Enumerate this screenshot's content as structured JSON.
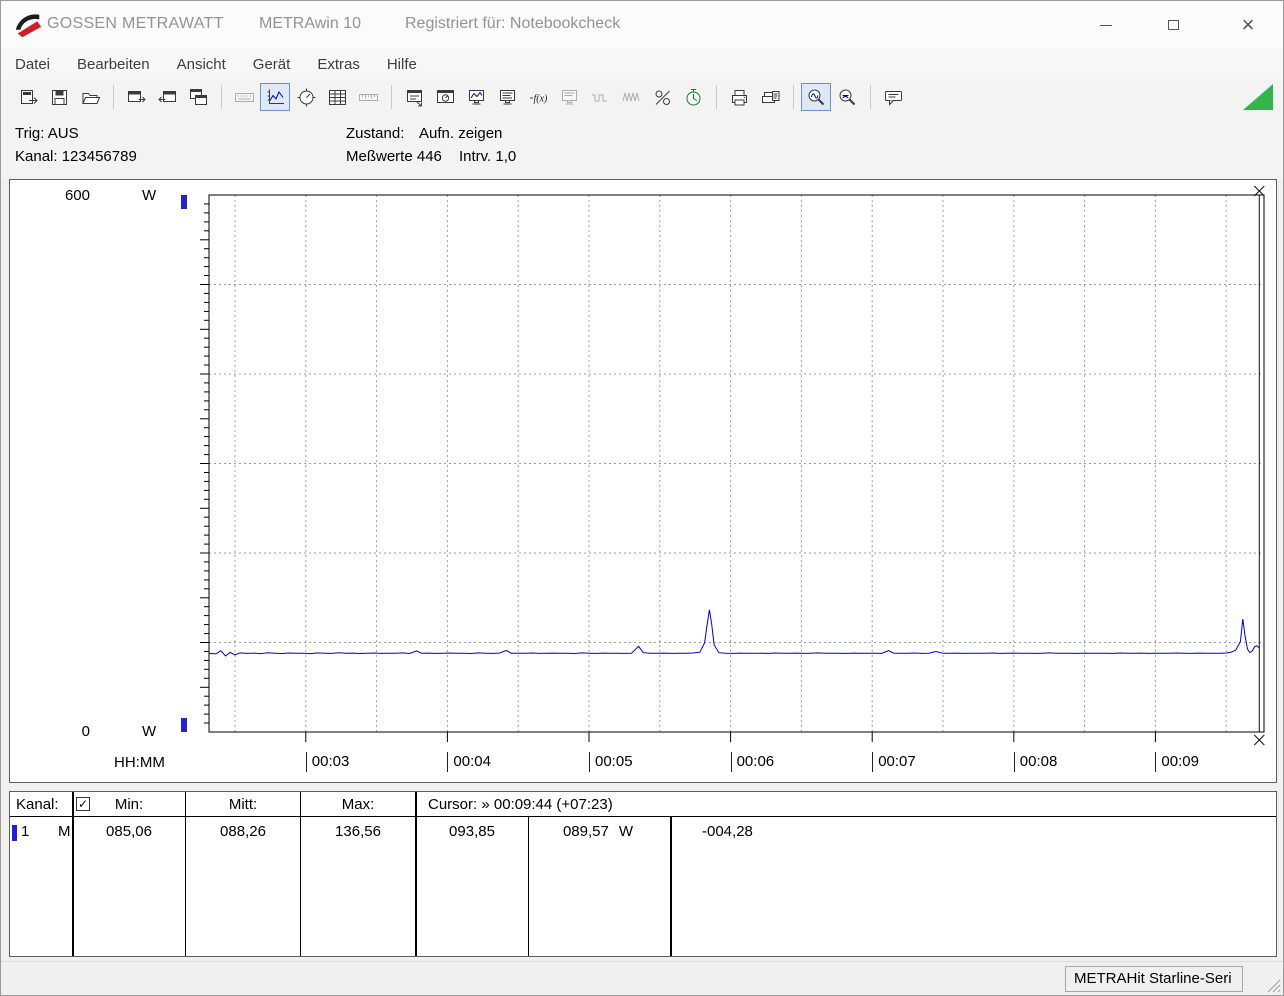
{
  "window": {
    "brand": "GOSSEN METRAWATT",
    "app": "METRAwin 10",
    "registered": "Registriert für: Notebookcheck"
  },
  "menu": {
    "items": [
      "Datei",
      "Bearbeiten",
      "Ansicht",
      "Gerät",
      "Extras",
      "Hilfe"
    ]
  },
  "toolbar": {
    "triangle_color": "#35b44a",
    "buttons": [
      {
        "name": "open-data"
      },
      {
        "name": "save"
      },
      {
        "name": "folder-open"
      },
      {
        "sep": true
      },
      {
        "name": "export-window"
      },
      {
        "name": "import-window"
      },
      {
        "name": "copy-window"
      },
      {
        "sep": true
      },
      {
        "name": "keyboard",
        "state": "disabled"
      },
      {
        "name": "chart-line",
        "state": "pressed"
      },
      {
        "name": "analog-gauge"
      },
      {
        "name": "value-table"
      },
      {
        "name": "ruler",
        "state": "disabled"
      },
      {
        "sep": true
      },
      {
        "name": "window-list"
      },
      {
        "name": "window-gauge"
      },
      {
        "name": "monitor-chart"
      },
      {
        "name": "monitor"
      },
      {
        "name": "function-fx"
      },
      {
        "name": "monitor-off",
        "state": "disabled"
      },
      {
        "name": "wave-low",
        "state": "disabled"
      },
      {
        "name": "wave-high",
        "state": "disabled"
      },
      {
        "name": "percent-timer"
      },
      {
        "name": "timer-clock"
      },
      {
        "sep": true
      },
      {
        "name": "print"
      },
      {
        "name": "print-page"
      },
      {
        "sep": true
      },
      {
        "name": "zoom-curve",
        "state": "pressed"
      },
      {
        "name": "zoom-reset"
      },
      {
        "sep": true
      },
      {
        "name": "annotation"
      }
    ]
  },
  "status_panel": {
    "trig": "Trig: AUS",
    "kanal": "Kanal: 123456789",
    "zustand_label": "Zustand:",
    "zustand_value": "Aufn. zeigen",
    "messwerte": "Meßwerte 446",
    "intrv": "Intrv. 1,0"
  },
  "chart_data": {
    "type": "line",
    "title": "",
    "unit": "W",
    "y_max_label": "600",
    "y_min_label": "0",
    "y_unit_top": "W",
    "y_unit_bottom": "W",
    "x_axis_label": "HH:MM",
    "ylim": [
      0,
      600
    ],
    "y_grid_step": 100,
    "y_tick_step": 10,
    "x_domain_seconds": [
      139,
      586
    ],
    "x_minor_grid_seconds": 30,
    "x_ticks": [
      {
        "s": 180,
        "label": "00:03"
      },
      {
        "s": 240,
        "label": "00:04"
      },
      {
        "s": 300,
        "label": "00:05"
      },
      {
        "s": 360,
        "label": "00:06"
      },
      {
        "s": 420,
        "label": "00:07"
      },
      {
        "s": 480,
        "label": "00:08"
      },
      {
        "s": 540,
        "label": "00:09"
      }
    ],
    "cursor": {
      "s": 584,
      "time_label": "00:09:44",
      "offset_label": "+07:23"
    },
    "line_color": "#0000cc",
    "channel_marker_color": "#2323cf",
    "grid": true,
    "legend": "none",
    "series": [
      {
        "name": "Kanal 1",
        "points": [
          [
            139,
            88
          ],
          [
            142,
            87.3
          ],
          [
            144,
            90.8
          ],
          [
            146,
            85.06
          ],
          [
            148,
            88.9
          ],
          [
            150,
            86.2
          ],
          [
            152,
            88.4
          ],
          [
            155,
            87.8
          ],
          [
            158,
            88.2
          ],
          [
            161,
            87.6
          ],
          [
            164,
            88.5
          ],
          [
            167,
            88
          ],
          [
            170,
            87.7
          ],
          [
            173,
            88.3
          ],
          [
            176,
            87.9
          ],
          [
            179,
            88.1
          ],
          [
            182,
            87.6
          ],
          [
            185,
            88.4
          ],
          [
            188,
            88
          ],
          [
            191,
            87.8
          ],
          [
            194,
            88.6
          ],
          [
            197,
            87.9
          ],
          [
            200,
            88.2
          ],
          [
            203,
            87.7
          ],
          [
            206,
            88
          ],
          [
            209,
            88.3
          ],
          [
            212,
            87.8
          ],
          [
            215,
            88.1
          ],
          [
            218,
            87.9
          ],
          [
            221,
            88.4
          ],
          [
            224,
            87.7
          ],
          [
            227,
            90.6
          ],
          [
            229,
            88
          ],
          [
            232,
            88.2
          ],
          [
            235,
            87.8
          ],
          [
            238,
            88
          ],
          [
            241,
            88.3
          ],
          [
            244,
            87.9
          ],
          [
            247,
            88.1
          ],
          [
            250,
            87.7
          ],
          [
            253,
            88.4
          ],
          [
            256,
            88
          ],
          [
            259,
            87.8
          ],
          [
            262,
            88.2
          ],
          [
            265,
            91.2
          ],
          [
            267,
            88
          ],
          [
            270,
            88.1
          ],
          [
            273,
            87.9
          ],
          [
            276,
            88.3
          ],
          [
            279,
            87.8
          ],
          [
            282,
            88
          ],
          [
            285,
            88.2
          ],
          [
            288,
            87.9
          ],
          [
            291,
            88.1
          ],
          [
            294,
            87.7
          ],
          [
            297,
            88.4
          ],
          [
            300,
            88
          ],
          [
            303,
            87.8
          ],
          [
            306,
            88.2
          ],
          [
            309,
            87.9
          ],
          [
            312,
            88.1
          ],
          [
            315,
            87.8
          ],
          [
            318,
            88
          ],
          [
            321,
            95.8
          ],
          [
            323,
            88.6
          ],
          [
            326,
            88
          ],
          [
            329,
            87.9
          ],
          [
            332,
            88.2
          ],
          [
            335,
            87.8
          ],
          [
            338,
            88.1
          ],
          [
            341,
            88
          ],
          [
            344,
            88.3
          ],
          [
            347,
            89.2
          ],
          [
            349,
            99.5
          ],
          [
            350,
            119
          ],
          [
            351,
            136.56
          ],
          [
            352,
            120.5
          ],
          [
            353,
            97.5
          ],
          [
            355,
            88.6
          ],
          [
            358,
            88
          ],
          [
            361,
            87.8
          ],
          [
            364,
            88.2
          ],
          [
            367,
            88
          ],
          [
            370,
            87.9
          ],
          [
            373,
            88.1
          ],
          [
            376,
            87.8
          ],
          [
            379,
            88.3
          ],
          [
            382,
            88
          ],
          [
            385,
            87.9
          ],
          [
            388,
            88.2
          ],
          [
            391,
            87.8
          ],
          [
            394,
            88
          ],
          [
            397,
            88.4
          ],
          [
            400,
            87.9
          ],
          [
            403,
            88.1
          ],
          [
            406,
            88
          ],
          [
            409,
            87.8
          ],
          [
            412,
            88.2
          ],
          [
            415,
            87.9
          ],
          [
            418,
            88.1
          ],
          [
            421,
            88
          ],
          [
            424,
            87.8
          ],
          [
            427,
            90.9
          ],
          [
            429,
            88.2
          ],
          [
            432,
            87.9
          ],
          [
            435,
            88
          ],
          [
            438,
            88.3
          ],
          [
            441,
            87.8
          ],
          [
            444,
            88.1
          ],
          [
            447,
            89.9
          ],
          [
            450,
            87.9
          ],
          [
            453,
            88
          ],
          [
            456,
            88.2
          ],
          [
            459,
            87.8
          ],
          [
            462,
            88.1
          ],
          [
            465,
            88
          ],
          [
            468,
            87.9
          ],
          [
            471,
            88.3
          ],
          [
            474,
            87.8
          ],
          [
            477,
            88
          ],
          [
            480,
            88.2
          ],
          [
            483,
            87.9
          ],
          [
            486,
            88.1
          ],
          [
            489,
            87.8
          ],
          [
            492,
            88
          ],
          [
            495,
            88.4
          ],
          [
            498,
            87.9
          ],
          [
            501,
            88.1
          ],
          [
            504,
            88
          ],
          [
            507,
            87.8
          ],
          [
            510,
            88.2
          ],
          [
            513,
            87.9
          ],
          [
            516,
            88.1
          ],
          [
            519,
            88
          ],
          [
            522,
            87.8
          ],
          [
            525,
            88.3
          ],
          [
            528,
            88
          ],
          [
            531,
            87.9
          ],
          [
            534,
            88.2
          ],
          [
            537,
            87.8
          ],
          [
            540,
            88
          ],
          [
            543,
            88.1
          ],
          [
            546,
            87.9
          ],
          [
            549,
            88.3
          ],
          [
            552,
            88
          ],
          [
            555,
            87.8
          ],
          [
            558,
            88.2
          ],
          [
            561,
            87.9
          ],
          [
            564,
            88
          ],
          [
            567,
            88.1
          ],
          [
            570,
            88.3
          ],
          [
            572,
            89
          ],
          [
            574,
            91.5
          ],
          [
            576,
            101
          ],
          [
            577,
            126.3
          ],
          [
            578,
            107
          ],
          [
            579,
            92.5
          ],
          [
            580,
            88.8
          ],
          [
            581,
            90.5
          ],
          [
            582,
            95.2
          ],
          [
            583,
            96.4
          ],
          [
            584,
            93.85
          ]
        ]
      }
    ]
  },
  "table": {
    "header": {
      "kanal": "Kanal:",
      "min": "Min:",
      "mitt": "Mitt:",
      "max": "Max:",
      "cursor": "Cursor: » 00:09:44 (+07:23)"
    },
    "checkbox_checked": true,
    "row": {
      "channel": "1",
      "mode": "M",
      "min": "085,06",
      "mitt": "088,26",
      "max": "136,56",
      "cursor_value": "093,85",
      "cursor_value2": "089,57",
      "unit": "W",
      "delta": "-004,28"
    }
  },
  "statusbar": {
    "device": "METRAHit Starline-Seri"
  }
}
